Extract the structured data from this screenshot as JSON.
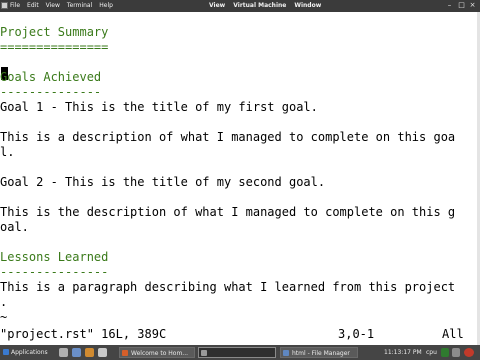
{
  "topbar": {
    "menu": [
      "File",
      "Edit",
      "View",
      "Terminal",
      "Help"
    ],
    "vm_menu": [
      "View",
      "Virtual Machine",
      "Window"
    ]
  },
  "editor": {
    "lines": [
      {
        "text": "Project Summary",
        "style": "heading"
      },
      {
        "text": "===============",
        "style": "heading"
      },
      {
        "text": "",
        "style": "normal"
      },
      {
        "text": "Goals Achieved",
        "style": "heading"
      },
      {
        "text": "--------------",
        "style": "heading"
      },
      {
        "text": "Goal 1 - This is the title of my first goal.",
        "style": "normal"
      },
      {
        "text": "",
        "style": "normal"
      },
      {
        "text": "This is a description of what I managed to complete on this goa",
        "style": "normal"
      },
      {
        "text": "l.",
        "style": "normal"
      },
      {
        "text": "",
        "style": "normal"
      },
      {
        "text": "Goal 2 - This is the title of my second goal.",
        "style": "normal"
      },
      {
        "text": "",
        "style": "normal"
      },
      {
        "text": "This is the description of what I managed to complete on this g",
        "style": "normal"
      },
      {
        "text": "oal.",
        "style": "normal"
      },
      {
        "text": "",
        "style": "normal"
      },
      {
        "text": "Lessons Learned",
        "style": "heading"
      },
      {
        "text": "---------------",
        "style": "heading"
      },
      {
        "text": "This is a paragraph describing what I learned from this project",
        "style": "normal"
      },
      {
        "text": ".",
        "style": "normal"
      },
      {
        "text": "~",
        "style": "normal"
      }
    ],
    "status": {
      "file": "\"project.rst\" 16L, 389C",
      "position": "3,0-1",
      "scroll": "All"
    }
  },
  "taskbar": {
    "apps_label": "Applications",
    "windows": [
      {
        "label": "Welcome to Hom...",
        "active": false
      },
      {
        "label": "",
        "active": true
      },
      {
        "label": "html - File Manager",
        "active": false
      }
    ],
    "clock": "11:13:17 PM",
    "cpu_label": "cpu"
  },
  "colors": {
    "heading": "#3a7a1a",
    "topbar": "#3b3b3b",
    "taskbar": "#454545"
  }
}
